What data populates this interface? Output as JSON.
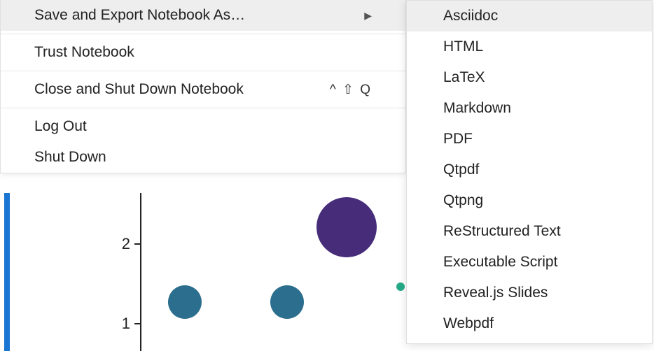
{
  "menu": {
    "items": [
      {
        "label": "Save and Export Notebook As…",
        "has_submenu": true,
        "highlighted": true
      },
      {
        "label": "Trust Notebook"
      },
      {
        "label": "Close and Shut Down Notebook",
        "shortcut": "^ ⇧ Q"
      },
      {
        "label": "Log Out"
      },
      {
        "label": "Shut Down"
      }
    ],
    "submenu_arrow": "▶"
  },
  "submenu": {
    "items": [
      {
        "label": "Asciidoc",
        "highlighted": true
      },
      {
        "label": "HTML"
      },
      {
        "label": "LaTeX"
      },
      {
        "label": "Markdown"
      },
      {
        "label": "PDF"
      },
      {
        "label": "Qtpdf"
      },
      {
        "label": "Qtpng"
      },
      {
        "label": "ReStructured Text"
      },
      {
        "label": "Executable Script"
      },
      {
        "label": "Reveal.js Slides"
      },
      {
        "label": "Webpdf"
      }
    ]
  },
  "chart_data": {
    "type": "scatter",
    "title": "",
    "xlabel": "",
    "ylabel": "",
    "y_ticks": [
      1,
      2
    ],
    "bubbles": [
      {
        "x": 0.18,
        "y": 1.3,
        "size": 48,
        "color": "#2b6e8e"
      },
      {
        "x": 0.46,
        "y": 1.3,
        "size": 48,
        "color": "#2b6e8e"
      },
      {
        "x": 0.7,
        "y": 1.3,
        "size": 12,
        "color": "#24a a88"
      },
      {
        "x": 0.78,
        "y": 2.2,
        "size": 86,
        "color": "#472c7a"
      }
    ]
  }
}
